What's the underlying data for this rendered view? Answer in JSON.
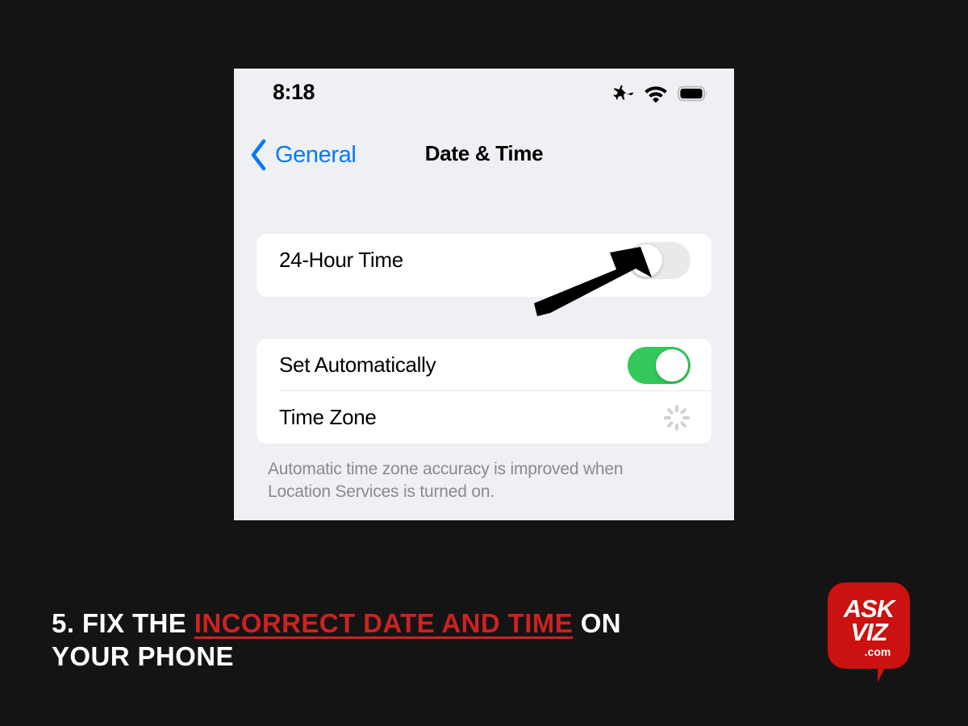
{
  "background_color": "#141414",
  "phone": {
    "screen_bg": "#eff0f3",
    "status_bar": {
      "time": "8:18",
      "icons": [
        "airplane-mode-icon",
        "wifi-icon",
        "battery-icon"
      ]
    },
    "nav": {
      "back_label": "General",
      "back_icon": "chevron-left-icon",
      "title": "Date & Time",
      "accent_color": "#007aff"
    },
    "groups": [
      {
        "rows": [
          {
            "label": "24-Hour Time",
            "control": "toggle",
            "value": "off",
            "toggle_off_color": "#e9e9eb"
          }
        ]
      },
      {
        "rows": [
          {
            "label": "Set Automatically",
            "control": "toggle",
            "value": "on",
            "toggle_on_color": "#34c759"
          },
          {
            "label": "Time Zone",
            "control": "spinner",
            "value": "loading"
          }
        ],
        "footer": "Automatic time zone accuracy is improved when Location Services is turned on."
      }
    ],
    "annotation": {
      "type": "arrow",
      "points_at": "24-Hour Time toggle",
      "color": "#000000"
    }
  },
  "caption": {
    "prefix": "5. FIX THE ",
    "highlight": "INCORRECT DATE AND TIME",
    "suffix": " ON YOUR PHONE",
    "text_color": "#ffffff",
    "highlight_color": "#cc2222"
  },
  "logo": {
    "line1": "ASK",
    "line2": "VIZ",
    "line3": ".com",
    "bubble_color": "#cc1111"
  }
}
